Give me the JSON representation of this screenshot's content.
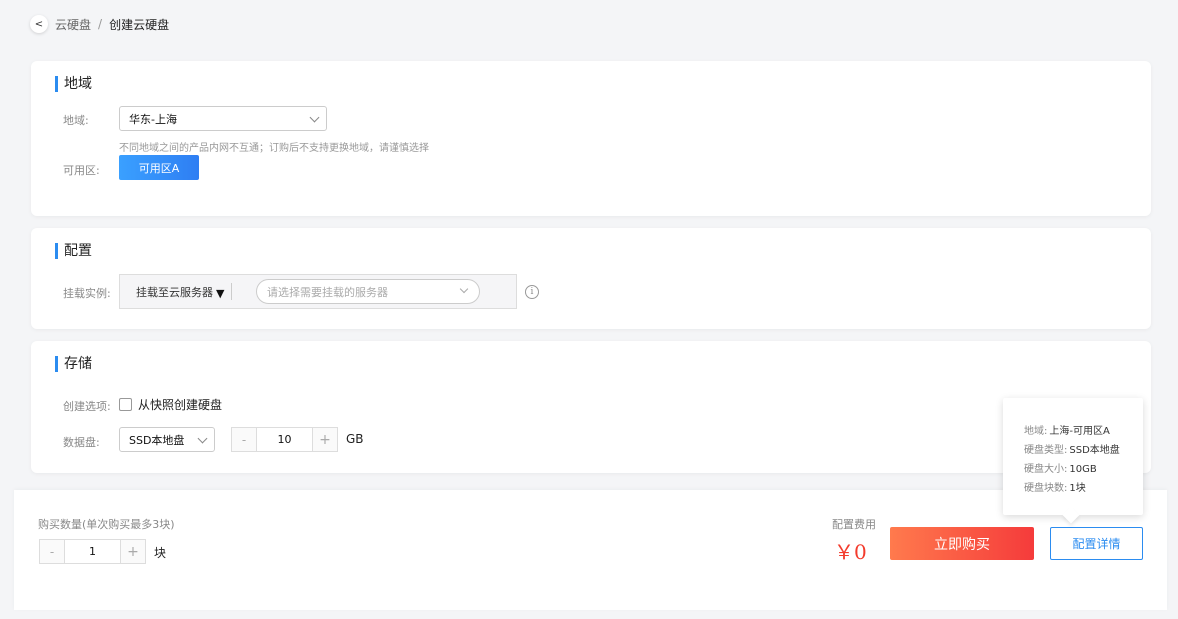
{
  "breadcrumb": {
    "back_icon": "<",
    "parent": "云硬盘",
    "separator": "/",
    "current": "创建云硬盘"
  },
  "region_section": {
    "title": "地域",
    "region_label": "地域:",
    "region_value": "华东-上海",
    "region_hint": "不同地域之间的产品内网不互通；订购后不支持更换地域，请谨慎选择",
    "zone_label": "可用区:",
    "zone_value": "可用区A"
  },
  "config_section": {
    "title": "配置",
    "mount_label": "挂载实例:",
    "mount_type": "挂载至云服务器",
    "mount_type_arrow": "▼",
    "server_placeholder": "请选择需要挂载的服务器",
    "info_icon": "i"
  },
  "storage_section": {
    "title": "存储",
    "create_option_label": "创建选项:",
    "from_snapshot_label": "从快照创建硬盘",
    "from_snapshot_checked": false,
    "data_disk_label": "数据盘:",
    "disk_type": "SSD本地盘",
    "disk_size_minus": "-",
    "disk_size": "10",
    "disk_size_plus": "+",
    "disk_unit": "GB"
  },
  "footer": {
    "qty_label": "购买数量(单次购买最多3块)",
    "qty_minus": "-",
    "qty_value": "1",
    "qty_plus": "+",
    "qty_unit": "块",
    "fee_label": "配置费用",
    "price": "￥0",
    "buy_button": "立即购买",
    "detail_button": "配置详情"
  },
  "detail_popover": {
    "rows": [
      {
        "label": "地域:",
        "value": "上海-可用区A"
      },
      {
        "label": "硬盘类型:",
        "value": "SSD本地盘"
      },
      {
        "label": "硬盘大小:",
        "value": "10GB"
      },
      {
        "label": "硬盘块数:",
        "value": "1块"
      }
    ]
  },
  "colors": {
    "accent": "#2b8cf0",
    "buy_button": "#f53b3b",
    "price": "#f33b2c",
    "background": "#f4f5f7"
  }
}
